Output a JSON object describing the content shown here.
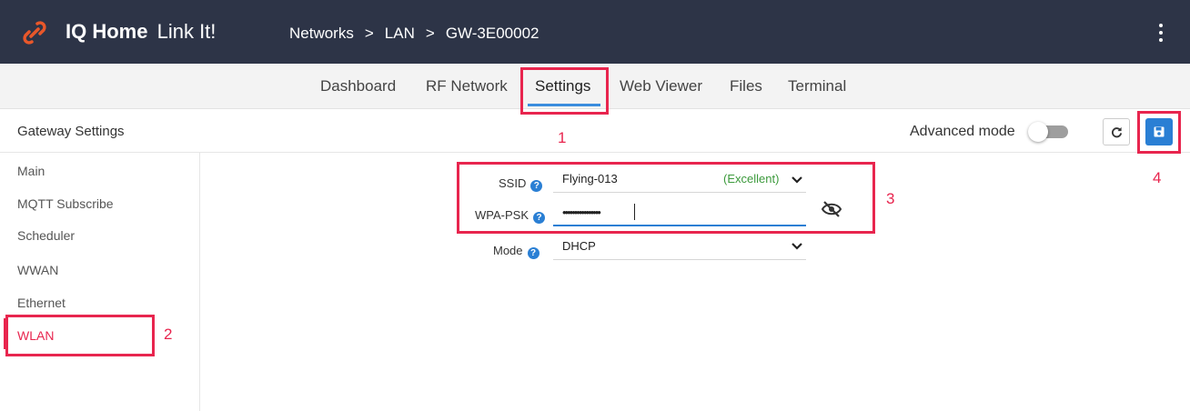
{
  "header": {
    "brand_bold": "IQ Home",
    "brand_sub": "Link It!",
    "breadcrumbs": [
      "Networks",
      "LAN",
      "GW-3E00002"
    ],
    "breadcrumb_sep": ">"
  },
  "tabs": [
    "Dashboard",
    "RF Network",
    "Settings",
    "Web Viewer",
    "Files",
    "Terminal"
  ],
  "active_tab": "Settings",
  "settings": {
    "title": "Gateway Settings",
    "advanced_mode_label": "Advanced mode",
    "advanced_mode_on": false
  },
  "sidebar": {
    "items": [
      "Main",
      "MQTT Subscribe",
      "Scheduler",
      "WWAN",
      "Ethernet",
      "WLAN"
    ],
    "active": "WLAN"
  },
  "form": {
    "ssid_label": "SSID",
    "ssid_value": "Flying-013",
    "ssid_quality": "(Excellent)",
    "psk_label": "WPA-PSK",
    "psk_value": "••••••••••••••••",
    "mode_label": "Mode",
    "mode_value": "DHCP",
    "help_glyph": "?"
  },
  "annotations": [
    "1",
    "2",
    "3",
    "4"
  ],
  "colors": {
    "header_bg": "#2d3447",
    "accent_blue": "#2a7fd4",
    "highlight_red": "#e8254e",
    "quality_green": "#3c9a3c"
  }
}
